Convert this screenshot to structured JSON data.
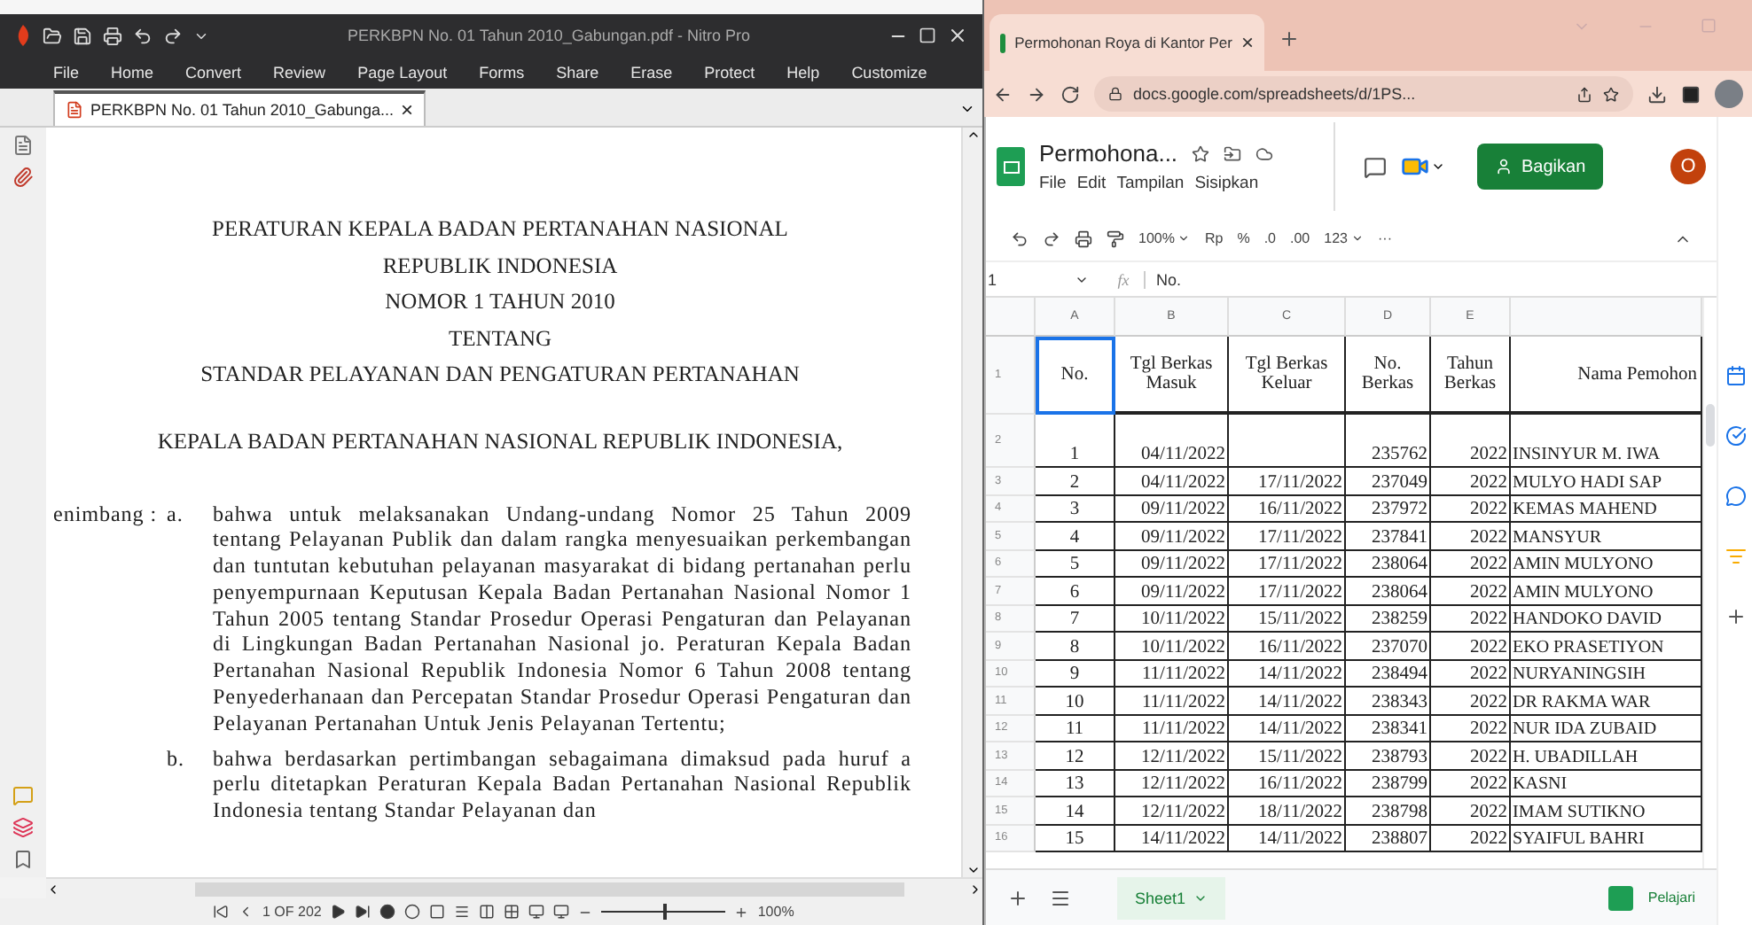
{
  "pdf_window": {
    "title": "PERKBPN No. 01 Tahun 2010_Gabungan.pdf - Nitro Pro",
    "ribbon_tabs": [
      "File",
      "Home",
      "Convert",
      "Review",
      "Page Layout",
      "Forms",
      "Share",
      "Erase",
      "Protect",
      "Help",
      "Customize"
    ],
    "doc_tab": {
      "label": "PERKBPN No. 01 Tahun 2010_Gabunga...",
      "close": "×",
      "selected": true
    },
    "document": {
      "headings": [
        "PERATURAN KEPALA BADAN PERTANAHAN NASIONAL",
        "REPUBLIK INDONESIA",
        "NOMOR 1 TAHUN 2010",
        "TENTANG",
        "STANDAR PELAYANAN DAN PENGATURAN PERTANAHAN"
      ],
      "subtitle": "KEPALA BADAN PERTANAHAN NASIONAL REPUBLIK INDONESIA,",
      "clauses": [
        {
          "label": "enimbang :",
          "marker": "a.",
          "text": "bahwa untuk melaksanakan Undang-undang Nomor 25 Tahun 2009 tentang Pelayanan Publik dan dalam rangka menyesuaikan perkembangan dan tuntutan kebutuhan pelayanan masyarakat di bidang pertanahan perlu penyempurnaan Keputusan Kepala Badan Pertanahan Nasional Nomor 1 Tahun 2005 tentang Standar Prosedur Operasi Pengaturan dan Pelayanan di Lingkungan Badan Pertanahan Nasional jo. Peraturan Kepala Badan Pertanahan Nasional Republik Indonesia Nomor 6 Tahun 2008 tentang Penyederhanaan dan Percepatan Standar Prosedur Operasi Pengaturan dan Pelayanan Pertanahan Untuk Jenis Pelayanan Tertentu;"
        },
        {
          "marker": "b.",
          "text": "bahwa berdasarkan pertimbangan sebagaimana dimaksud pada huruf a perlu ditetapkan Peraturan Kepala Badan Pertanahan Nasional Republik Indonesia tentang Standar Pelayanan dan"
        }
      ]
    },
    "status_bar": {
      "page": "1 OF 202",
      "zoom": "100%",
      "zoom_slider": {
        "level": 0.5
      }
    }
  },
  "browser": {
    "tab": {
      "title": "Permohonan Roya di Kantor Per",
      "close": "×",
      "selected": true
    },
    "url": "docs.google.com/spreadsheets/d/1PS...",
    "sheet": {
      "title": "Permohona...",
      "menu": [
        "File",
        "Edit",
        "Tampilan",
        "Sisipkan"
      ],
      "share_button": "Bagikan",
      "avatar": "O",
      "toolbar": {
        "zoom": "100%",
        "currency": "Rp",
        "percent": "%",
        "decrease_decimals": ".0",
        "increase_decimals": ".00",
        "format": "123",
        "more": "···"
      },
      "name_box": "1",
      "fx": "fx",
      "formula": "No.",
      "columns": [
        "A",
        "B",
        "C",
        "D",
        "E"
      ],
      "header_row": {
        "row": "1",
        "cells": [
          {
            "text": "No.",
            "selected": true
          },
          {
            "text": "Tgl Berkas Masuk",
            "selected": false
          },
          {
            "text": "Tgl Berkas Keluar",
            "selected": false
          },
          {
            "text": "No. Berkas",
            "selected": false
          },
          {
            "text": "Tahun Berkas",
            "selected": false
          },
          {
            "text": "Nama Pemohon",
            "selected": false
          }
        ]
      },
      "rows": [
        {
          "row": "2",
          "cells": [
            "1",
            "04/11/2022",
            null,
            "235762",
            "2022",
            "INSINYUR M. IWA"
          ]
        },
        {
          "row": "3",
          "cells": [
            "2",
            "04/11/2022",
            "17/11/2022",
            "237049",
            "2022",
            "MULYO HADI SAP"
          ]
        },
        {
          "row": "4",
          "cells": [
            "3",
            "09/11/2022",
            "16/11/2022",
            "237972",
            "2022",
            "KEMAS MAHEND"
          ]
        },
        {
          "row": "5",
          "cells": [
            "4",
            "09/11/2022",
            "17/11/2022",
            "237841",
            "2022",
            "MANSYUR"
          ]
        },
        {
          "row": "6",
          "cells": [
            "5",
            "09/11/2022",
            "17/11/2022",
            "238064",
            "2022",
            "AMIN MULYONO"
          ]
        },
        {
          "row": "7",
          "cells": [
            "6",
            "09/11/2022",
            "17/11/2022",
            "238064",
            "2022",
            "AMIN MULYONO"
          ]
        },
        {
          "row": "8",
          "cells": [
            "7",
            "10/11/2022",
            "15/11/2022",
            "238259",
            "2022",
            "HANDOKO DAVID"
          ]
        },
        {
          "row": "9",
          "cells": [
            "8",
            "10/11/2022",
            "16/11/2022",
            "237070",
            "2022",
            "EKO PRASETIYON"
          ]
        },
        {
          "row": "10",
          "cells": [
            "9",
            "11/11/2022",
            "14/11/2022",
            "238494",
            "2022",
            "NURYANINGSIH"
          ]
        },
        {
          "row": "11",
          "cells": [
            "10",
            "11/11/2022",
            "14/11/2022",
            "238343",
            "2022",
            "DR RAKMA WAR"
          ]
        },
        {
          "row": "12",
          "cells": [
            "11",
            "11/11/2022",
            "14/11/2022",
            "238341",
            "2022",
            "NUR IDA ZUBAID"
          ]
        },
        {
          "row": "13",
          "cells": [
            "12",
            "12/11/2022",
            "15/11/2022",
            "238793",
            "2022",
            "H. UBADILLAH"
          ]
        },
        {
          "row": "14",
          "cells": [
            "13",
            "12/11/2022",
            "16/11/2022",
            "238799",
            "2022",
            "KASNI"
          ]
        },
        {
          "row": "15",
          "cells": [
            "14",
            "12/11/2022",
            "18/11/2022",
            "238798",
            "2022",
            "IMAM SUTIKNO"
          ]
        },
        {
          "row": "16",
          "cells": [
            "15",
            "14/11/2022",
            "14/11/2022",
            "238807",
            "2022",
            "SYAIFUL BAHRI"
          ]
        }
      ],
      "sheet_tabs": [
        {
          "label": "Sheet1",
          "selected": true
        }
      ],
      "explore": "Pelajari"
    }
  }
}
